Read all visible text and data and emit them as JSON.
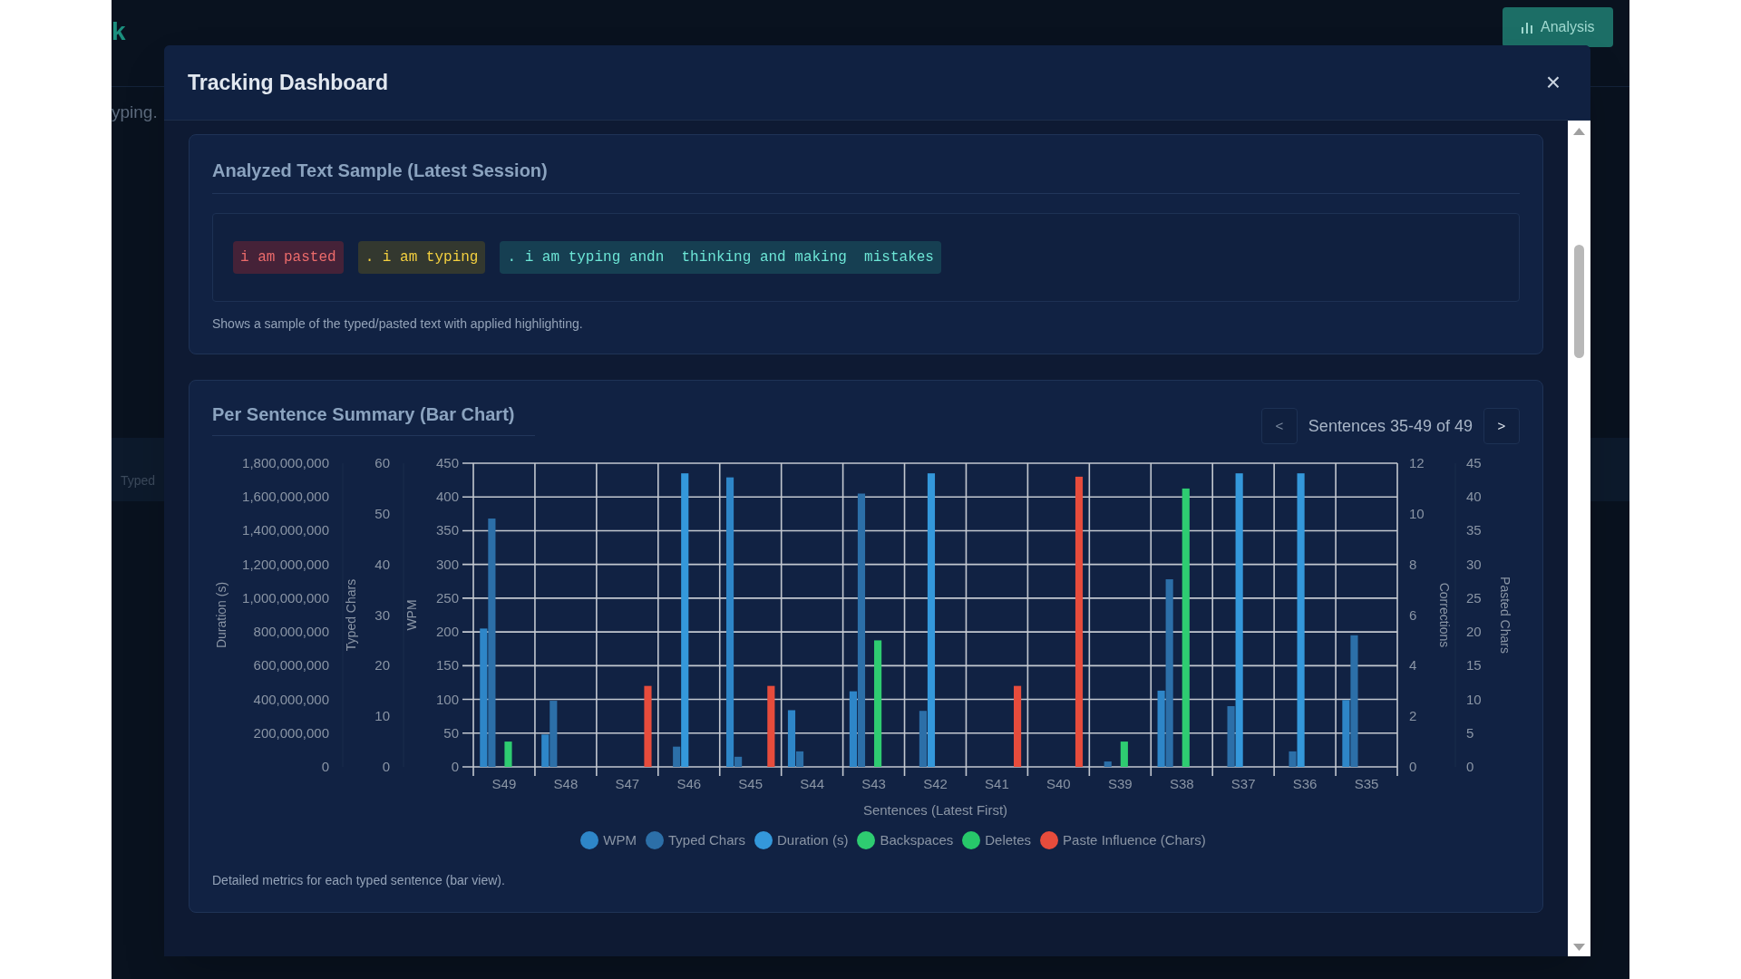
{
  "background_app": {
    "logo_fragment": "k",
    "text_fragment": "yping.",
    "column_fragment": "Typed",
    "analysis_button": {
      "label": "Analysis"
    }
  },
  "modal": {
    "title": "Tracking Dashboard",
    "close_label": "×",
    "text_sample": {
      "title": "Analyzed Text Sample (Latest Session)",
      "segments": [
        {
          "kind": "pasted",
          "text": "i am pasted"
        },
        {
          "kind": "typed",
          "text": ". i am typing"
        },
        {
          "kind": "corrected",
          "text": ". i am typing andn  thinking and making  mistakes"
        }
      ],
      "caption": "Shows a sample of the typed/pasted text with applied highlighting."
    },
    "summary": {
      "title": "Per Sentence Summary (Bar Chart)",
      "pagination": {
        "prev": "<",
        "range": "Sentences 35-49 of 49",
        "next": ">"
      },
      "outer_left_axes": [
        {
          "title": "Duration (s)",
          "ticks": [
            "1,800,000,000",
            "1,600,000,000",
            "1,400,000,000",
            "1,200,000,000",
            "1,000,000,000",
            "800,000,000",
            "600,000,000",
            "400,000,000",
            "200,000,000",
            "0"
          ]
        },
        {
          "title": "Typed Chars",
          "ticks": [
            "60",
            "50",
            "40",
            "30",
            "20",
            "10",
            "0"
          ]
        }
      ],
      "chart_data": {
        "type": "bar",
        "xlabel": "Sentences (Latest First)",
        "ylabel": "WPM",
        "stacked": false,
        "grid": true,
        "legend": "bottom",
        "categories": [
          "S49",
          "S48",
          "S47",
          "S46",
          "S45",
          "S44",
          "S43",
          "S42",
          "S41",
          "S40",
          "S39",
          "S38",
          "S37",
          "S36",
          "S35"
        ],
        "ylim": [
          0,
          450
        ],
        "yticks": [
          0,
          50,
          100,
          150,
          200,
          250,
          300,
          350,
          400,
          450
        ],
        "y2label": "Corrections",
        "y2lim": [
          0,
          12
        ],
        "y2ticks": [
          0,
          2,
          4,
          6,
          8,
          10,
          12
        ],
        "y3label": "Pasted Chars",
        "y3lim": [
          0,
          45
        ],
        "y3ticks": [
          0,
          5,
          10,
          15,
          20,
          25,
          30,
          35,
          40,
          45
        ],
        "series": [
          {
            "name": "WPM",
            "color": "#2e86c8",
            "values": [
              205,
              48,
              0,
              0,
              429,
              84,
              112,
              0,
              0,
              0,
              0,
              113,
              0,
              0,
              99
            ]
          },
          {
            "name": "Typed Chars",
            "color": "#2c6fa8",
            "values": [
              368,
              98,
              0,
              30,
              15,
              23,
              405,
              83,
              0,
              0,
              8,
              278,
              90,
              23,
              195
            ]
          },
          {
            "name": "Duration (s)",
            "color": "#3498db",
            "values": [
              0,
              0,
              0,
              435,
              0,
              0,
              0,
              435,
              0,
              0,
              0,
              0,
              435,
              435,
              0
            ]
          },
          {
            "name": "Backspaces",
            "color": "#2ecc71",
            "axis": "y2",
            "values": [
              1,
              0,
              0,
              0,
              0,
              0,
              5,
              0,
              0,
              0,
              1,
              11,
              0,
              0,
              0
            ]
          },
          {
            "name": "Deletes",
            "color": "#27c86a",
            "axis": "y2",
            "values": [
              0,
              0,
              0,
              0,
              0,
              0,
              0,
              0,
              0,
              0,
              0,
              0,
              0,
              0,
              0
            ]
          },
          {
            "name": "Paste Influence (Chars)",
            "color": "#e74c3c",
            "axis": "y3",
            "values": [
              0,
              0,
              12,
              0,
              12,
              0,
              0,
              0,
              12,
              43,
              0,
              0,
              0,
              0,
              0
            ]
          }
        ]
      },
      "caption": "Detailed metrics for each typed sentence (bar view)."
    }
  }
}
